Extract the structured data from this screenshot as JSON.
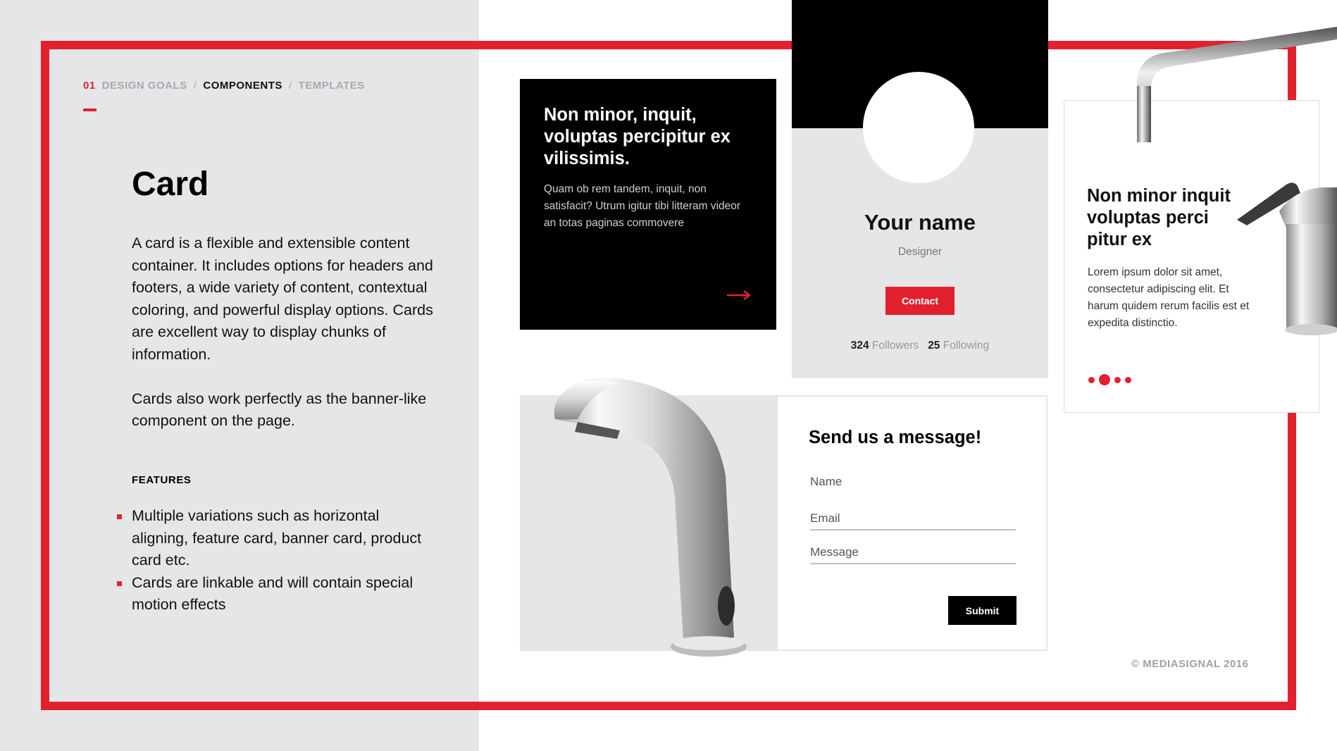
{
  "breadcrumb": {
    "number": "01",
    "items": [
      "DESIGN GOALS",
      "COMPONENTS",
      "TEMPLATES"
    ],
    "separator": "/"
  },
  "page": {
    "title": "Card",
    "description": [
      "A card is a flexible and extensible content container. It includes options for headers and footers, a wide variety of content, contextual coloring, and powerful display options. Cards are excellent way to display chunks of information.",
      "Cards also work perfectly as the banner-like component on the page."
    ],
    "features_heading": "FEATURES",
    "features": [
      "Multiple variations such as horizontal aligning, feature card, banner card, product card etc.",
      "Cards are linkable and will contain special motion effects"
    ]
  },
  "dark_card": {
    "title": "Non minor, inquit, voluptas percipitur ex vilissimis.",
    "body": "Quam ob rem tandem, inquit, non satisfacit? Utrum igitur tibi litteram videor an totas paginas commovere",
    "arrow_icon": "arrow-right-icon"
  },
  "profile_card": {
    "name": "Your name",
    "role": "Designer",
    "contact_label": "Contact",
    "followers_count": "324",
    "followers_label": "Followers",
    "following_count": "25",
    "following_label": "Following"
  },
  "product_card": {
    "title": "Non minor inquit voluptas perci pitur ex",
    "body": "Lorem ipsum dolor sit amet, consectetur adipiscing elit. Et harum quidem rerum facilis est et expedita distinctio.",
    "slides": 4,
    "active_slide": 1
  },
  "form_card": {
    "title": "Send us a message!",
    "name_placeholder": "Name",
    "email_placeholder": "Email",
    "message_placeholder": "Message",
    "submit_label": "Submit"
  },
  "footer": {
    "copyright": "© MEDIASIGNAL 2016"
  },
  "colors": {
    "accent": "#e3202e",
    "panel": "#e5e6e8",
    "dark": "#000000"
  }
}
